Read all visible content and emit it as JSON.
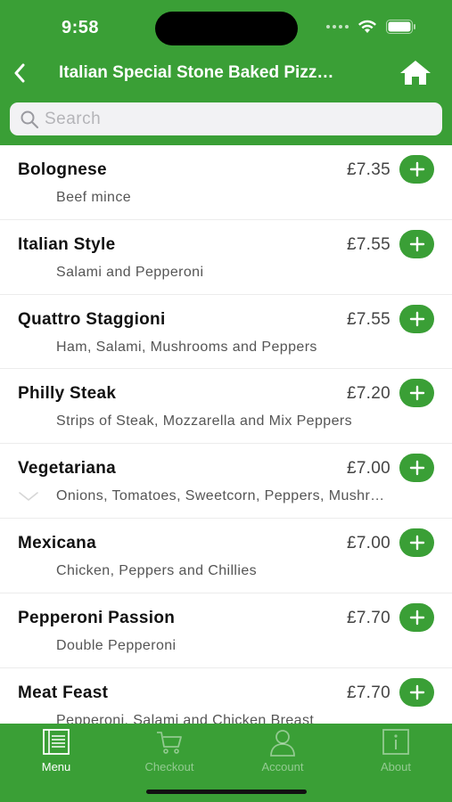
{
  "status_bar": {
    "time": "9:58"
  },
  "nav": {
    "title": "Italian Special Stone Baked Pizz…"
  },
  "search": {
    "placeholder": "Search",
    "value": ""
  },
  "colors": {
    "brand_green": "#3a9f36",
    "divider": "#ececec"
  },
  "menu_items": [
    {
      "name": "Bolognese",
      "price": "£7.35",
      "description": "Beef mince"
    },
    {
      "name": "Italian Style",
      "price": "£7.55",
      "description": "Salami and Pepperoni"
    },
    {
      "name": "Quattro Staggioni",
      "price": "£7.55",
      "description": "Ham, Salami, Mushrooms and Peppers"
    },
    {
      "name": "Philly Steak",
      "price": "£7.20",
      "description": "Strips of Steak, Mozzarella and Mix Peppers"
    },
    {
      "name": "Vegetariana",
      "price": "£7.00",
      "description": "Onions, Tomatoes, Sweetcorn, Peppers, Mushr…",
      "expandable": true
    },
    {
      "name": "Mexicana",
      "price": "£7.00",
      "description": "Chicken, Peppers and Chillies"
    },
    {
      "name": "Pepperoni Passion",
      "price": "£7.70",
      "description": "Double Pepperoni"
    },
    {
      "name": "Meat Feast",
      "price": "£7.70",
      "description": "Pepperoni, Salami and Chicken Breast"
    }
  ],
  "tabs": [
    {
      "label": "Menu",
      "icon": "menu-book-icon",
      "active": true
    },
    {
      "label": "Checkout",
      "icon": "cart-icon",
      "active": false
    },
    {
      "label": "Account",
      "icon": "person-icon",
      "active": false
    },
    {
      "label": "About",
      "icon": "info-icon",
      "active": false
    }
  ]
}
